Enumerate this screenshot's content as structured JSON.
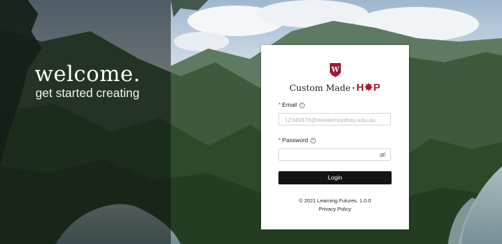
{
  "welcome": {
    "title": "welcome.",
    "subtitle": "get started creating"
  },
  "brand": {
    "shield_letter": "W",
    "text": "Custom Made",
    "separator": "·",
    "hsp": "H✸P",
    "accent_color": "#9d1c32"
  },
  "email": {
    "required_mark": "*",
    "label": "Email",
    "help_icon": "?",
    "placeholder": "12345678@westernsydney.edu.au"
  },
  "password": {
    "required_mark": "*",
    "label": "Password",
    "help_icon": "?",
    "value": "",
    "toggle_icon": "eye-hidden-icon"
  },
  "login": {
    "label": "Login"
  },
  "footer": {
    "copyright": "© 2021 Learning Futures. 1.0.0",
    "privacy": "Privacy Policy"
  }
}
